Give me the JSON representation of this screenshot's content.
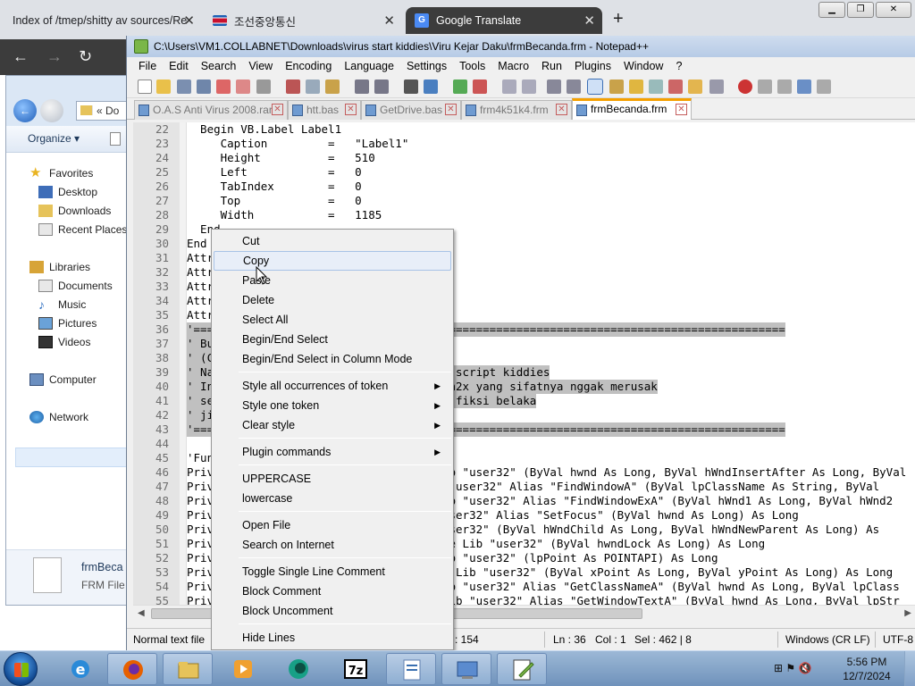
{
  "browser": {
    "tabs": [
      {
        "label": "Index of /tmep/shitty av sources/Re"
      },
      {
        "label": "조선중앙통신"
      },
      {
        "label": "Google Translate"
      }
    ],
    "new_tab": "+",
    "close_glyph": "✕"
  },
  "explorer": {
    "address": "« Do",
    "organize": "Organize ▾",
    "nav": {
      "favorites": "Favorites",
      "desktop": "Desktop",
      "downloads": "Downloads",
      "recent": "Recent Places",
      "libraries": "Libraries",
      "documents": "Documents",
      "music": "Music",
      "pictures": "Pictures",
      "videos": "Videos",
      "computer": "Computer",
      "network": "Network"
    },
    "file": {
      "name": "frmBeca",
      "type": "FRM File"
    }
  },
  "npp": {
    "title": "C:\\Users\\VM1.COLLABNET\\Downloads\\virus start kiddies\\Viru Kejar Daku\\frmBecanda.frm - Notepad++",
    "menu": [
      "File",
      "Edit",
      "Search",
      "View",
      "Encoding",
      "Language",
      "Settings",
      "Tools",
      "Macro",
      "Run",
      "Plugins",
      "Window",
      "?"
    ],
    "tabs": [
      {
        "label": "O.A.S Anti Virus 2008.rar"
      },
      {
        "label": "htt.bas"
      },
      {
        "label": "GetDrive.bas"
      },
      {
        "label": "frm4k51k4.frm"
      },
      {
        "label": "frmBecanda.frm"
      }
    ],
    "lines": [
      {
        "n": "22",
        "t": "  Begin VB.Label Label1"
      },
      {
        "n": "23",
        "t": "     Caption         =   \"Label1\""
      },
      {
        "n": "24",
        "t": "     Height          =   510"
      },
      {
        "n": "25",
        "t": "     Left            =   0"
      },
      {
        "n": "26",
        "t": "     TabIndex        =   0"
      },
      {
        "n": "27",
        "t": "     Top             =   0"
      },
      {
        "n": "28",
        "t": "     Width           =   1185"
      },
      {
        "n": "29",
        "t": "  End"
      },
      {
        "n": "30",
        "t": "End"
      },
      {
        "n": "31",
        "t": "Attr"
      },
      {
        "n": "32",
        "t": "Attr"
      },
      {
        "n": "33",
        "t": "Attr"
      },
      {
        "n": "34",
        "t": "Attr"
      },
      {
        "n": "35",
        "t": "Attr"
      },
      {
        "n": "36",
        "t": "'========================================================================================"
      },
      {
        "n": "37",
        "t": "' Bu                                 p)"
      },
      {
        "n": "38",
        "t": "' (C"
      },
      {
        "n": "39",
        "t": "' Na                                 is script kiddies"
      },
      {
        "n": "40",
        "t": "' In                                 ain2x yang sifatnya nggak merusak"
      },
      {
        "n": "41",
        "t": "' se                                 ya fiksi belaka"
      },
      {
        "n": "42",
        "t": "' ji"
      },
      {
        "n": "43",
        "t": "'========================================================================================"
      },
      {
        "n": "44",
        "t": ""
      },
      {
        "n": "45",
        "t": "'Fun"
      },
      {
        "n": "46",
        "t": "Priv                                 Lib \"user32\" (ByVal hwnd As Long, ByVal hWndInsertAfter As Long, ByVal"
      },
      {
        "n": "47",
        "t": "Priv                                ib \"user32\" Alias \"FindWindowA\" (ByVal lpClassName As String, ByVal"
      },
      {
        "n": "48",
        "t": "Priv                                 Lib \"user32\" Alias \"FindWindowExA\" (ByVal hWnd1 As Long, ByVal hWnd2"
      },
      {
        "n": "49",
        "t": "Priv                                 \"user32\" Alias \"SetFocus\" (ByVal hwnd As Long) As Long"
      },
      {
        "n": "50",
        "t": "Priv                                 \"user32\" (ByVal hWndChild As Long, ByVal hWndNewParent As Long) As"
      },
      {
        "n": "51",
        "t": "Priv                                date Lib \"user32\" (ByVal hwndLock As Long) As Long"
      },
      {
        "n": "52",
        "t": "Priv                                 Lib \"user32\" (lpPoint As POINTAPI) As Long"
      },
      {
        "n": "53",
        "t": "Priv                                int Lib \"user32\" (ByVal xPoint As Long, ByVal yPoint As Long) As Long"
      },
      {
        "n": "54",
        "t": "Priv                                 Lib \"user32\" Alias \"GetClassNameA\" (ByVal hwnd As Long, ByVal lpClass"
      },
      {
        "n": "55",
        "t": "Priv                                t Lib \"user32\" Alias \"GetWindowTextA\" (ByVal hwnd As Long, ByVal lpStr"
      }
    ],
    "status": {
      "type": "Normal text file",
      "length": ": 154",
      "ln": "Ln : 36",
      "col": "Col : 1",
      "sel": "Sel : 462 | 8",
      "eol": "Windows (CR LF)",
      "enc": "UTF-8"
    }
  },
  "context_menu": {
    "items": [
      {
        "label": "Cut"
      },
      {
        "label": "Copy"
      },
      {
        "label": "Paste"
      },
      {
        "label": "Delete"
      },
      {
        "label": "Select All"
      },
      {
        "label": "Begin/End Select"
      },
      {
        "label": "Begin/End Select in Column Mode"
      },
      {
        "label": "Style all occurrences of token"
      },
      {
        "label": "Style one token"
      },
      {
        "label": "Clear style"
      },
      {
        "label": "Plugin commands"
      },
      {
        "label": "UPPERCASE"
      },
      {
        "label": "lowercase"
      },
      {
        "label": "Open File"
      },
      {
        "label": "Search on Internet"
      },
      {
        "label": "Toggle Single Line Comment"
      },
      {
        "label": "Block Comment"
      },
      {
        "label": "Block Uncomment"
      },
      {
        "label": "Hide Lines"
      }
    ],
    "submenu_glyph": "▶"
  },
  "taskbar": {
    "time": "5:56 PM",
    "date": "12/7/2024"
  }
}
